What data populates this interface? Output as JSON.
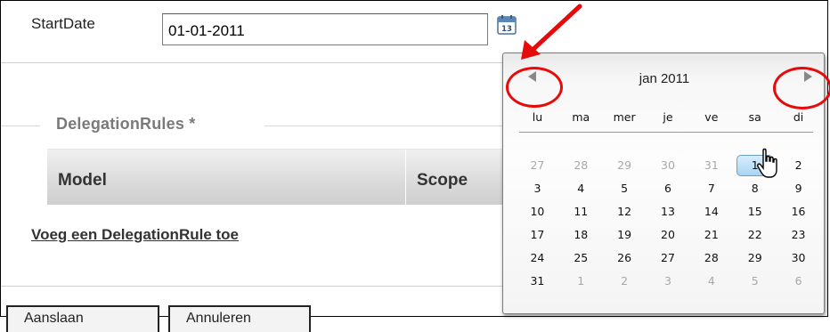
{
  "form": {
    "start_date_label": "StartDate",
    "start_date_value": "01-01-2011",
    "calendar_button_icon": "calendar-icon"
  },
  "delegation": {
    "legend": "DelegationRules *",
    "columns": [
      "Model",
      "Scope"
    ],
    "add_link": "Voeg een DelegationRule toe"
  },
  "buttons": {
    "save_label": "Aanslaan",
    "cancel_label": "Annuleren"
  },
  "calendar": {
    "title": "jan 2011",
    "prev_icon": "triangle-left-icon",
    "next_icon": "triangle-right-icon",
    "weekdays": [
      "lu",
      "ma",
      "mer",
      "je",
      "ve",
      "sa",
      "di"
    ],
    "weeks": [
      [
        {
          "d": "27",
          "o": true
        },
        {
          "d": "28",
          "o": true
        },
        {
          "d": "29",
          "o": true
        },
        {
          "d": "30",
          "o": true
        },
        {
          "d": "31",
          "o": true
        },
        {
          "d": "1",
          "o": false,
          "sel": true
        },
        {
          "d": "2",
          "o": false
        }
      ],
      [
        {
          "d": "3"
        },
        {
          "d": "4"
        },
        {
          "d": "5"
        },
        {
          "d": "6"
        },
        {
          "d": "7"
        },
        {
          "d": "8"
        },
        {
          "d": "9"
        }
      ],
      [
        {
          "d": "10"
        },
        {
          "d": "11"
        },
        {
          "d": "12"
        },
        {
          "d": "13"
        },
        {
          "d": "14"
        },
        {
          "d": "15"
        },
        {
          "d": "16"
        }
      ],
      [
        {
          "d": "17"
        },
        {
          "d": "18"
        },
        {
          "d": "19"
        },
        {
          "d": "20"
        },
        {
          "d": "21"
        },
        {
          "d": "22"
        },
        {
          "d": "23"
        }
      ],
      [
        {
          "d": "24"
        },
        {
          "d": "25"
        },
        {
          "d": "26"
        },
        {
          "d": "27"
        },
        {
          "d": "28"
        },
        {
          "d": "29"
        },
        {
          "d": "30"
        }
      ],
      [
        {
          "d": "31"
        },
        {
          "d": "1",
          "o": true
        },
        {
          "d": "2",
          "o": true
        },
        {
          "d": "3",
          "o": true
        },
        {
          "d": "4",
          "o": true
        },
        {
          "d": "5",
          "o": true
        },
        {
          "d": "6",
          "o": true
        }
      ]
    ]
  },
  "colors": {
    "annotation": "#e60a0a",
    "selected_day": "#a9d4f4"
  }
}
